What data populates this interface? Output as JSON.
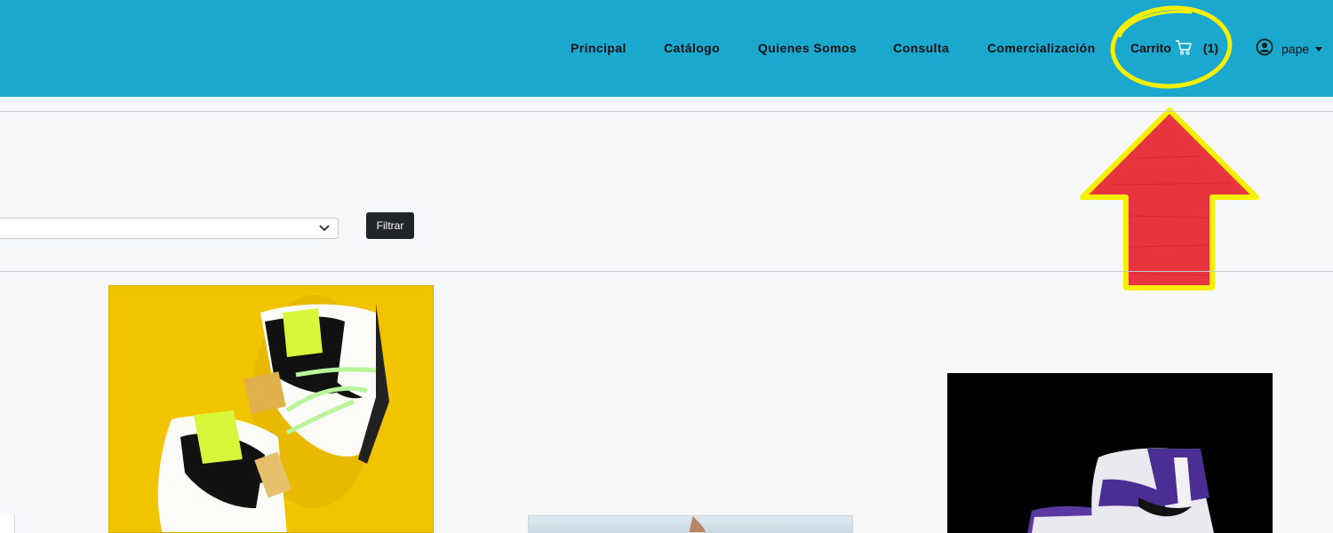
{
  "navbar": {
    "links": [
      {
        "label": "Principal"
      },
      {
        "label": "Catálogo"
      },
      {
        "label": "Quienes Somos"
      },
      {
        "label": "Consulta"
      },
      {
        "label": "Comercialización"
      }
    ],
    "cart": {
      "label": "Carrito",
      "count": "(1)",
      "icon": "cart-icon"
    },
    "user": {
      "name": "pape",
      "icon": "user-circle-icon"
    }
  },
  "filter": {
    "select_value": "",
    "button_label": "Filtrar"
  },
  "colors": {
    "navbar": "#1ba8cf",
    "annotation_circle": "#f4f000",
    "annotation_arrow": "#e8343c",
    "button": "#212529"
  }
}
